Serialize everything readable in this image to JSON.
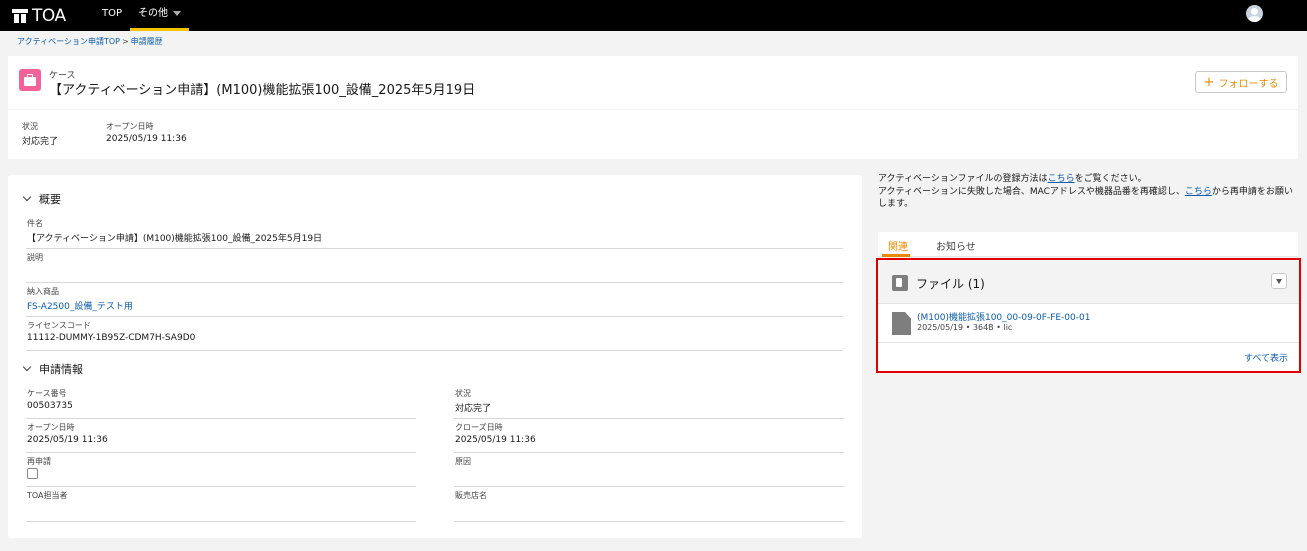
{
  "nav": {
    "logo": "TOA",
    "items": [
      "TOP",
      "その他"
    ]
  },
  "breadcrumb": {
    "items": [
      "アクティベーション申請TOP",
      "申請履歴"
    ],
    "separator": ">"
  },
  "header": {
    "object_type": "ケース",
    "title": "【アクティベーション申請】(M100)機能拡張100_設備_2025年5月19日",
    "follow_button": "フォローする",
    "fields": [
      {
        "label": "状況",
        "value": "対応完了"
      },
      {
        "label": "オープン日時",
        "value": "2025/05/19 11:36"
      }
    ]
  },
  "overview": {
    "heading": "概要",
    "fields": {
      "subject": {
        "label": "件名",
        "value": "【アクティベーション申請】(M100)機能拡張100_設備_2025年5月19日"
      },
      "description": {
        "label": "説明",
        "value": ""
      },
      "product": {
        "label": "納入商品",
        "value": "FS-A2500_設備_テスト用"
      },
      "license": {
        "label": "ライセンスコード",
        "value": "11112-DUMMY-1B95Z-CDM7H-SA9D0"
      }
    }
  },
  "request_info": {
    "heading": "申請情報",
    "fields": {
      "case_number": {
        "label": "ケース番号",
        "value": "00503735"
      },
      "status": {
        "label": "状況",
        "value": "対応完了"
      },
      "open_datetime": {
        "label": "オープン日時",
        "value": "2025/05/19 11:36"
      },
      "close_datetime": {
        "label": "クローズ日時",
        "value": "2025/05/19 11:36"
      },
      "reapply": {
        "label": "再申請",
        "checked": false
      },
      "cause": {
        "label": "原因",
        "value": ""
      },
      "toa_owner": {
        "label": "TOA担当者",
        "value": ""
      },
      "distributor": {
        "label": "販売店名",
        "value": ""
      }
    }
  },
  "info": {
    "line1_pre": "アクティベーションファイルの登録方法は",
    "line1_link": "こちら",
    "line1_post": "をご覧ください。",
    "line2_pre": "アクティベーションに失敗した場合、MACアドレスや機器品番を再確認し、",
    "line2_link": "こちら",
    "line2_post": "から再申請をお願いします。"
  },
  "tabs": {
    "related": "関連",
    "notices": "お知らせ"
  },
  "files": {
    "title": "ファイル (1)",
    "items": [
      {
        "name": "(M100)機能拡張100_00-09-0F-FE-00-01",
        "meta": "2025/05/19 • 364B • lic"
      }
    ],
    "view_all": "すべて表示"
  },
  "colors": {
    "accent": "#e68a00",
    "link": "#0b5cab",
    "case_icon": "#f2619a",
    "highlight_border": "#e00000"
  }
}
